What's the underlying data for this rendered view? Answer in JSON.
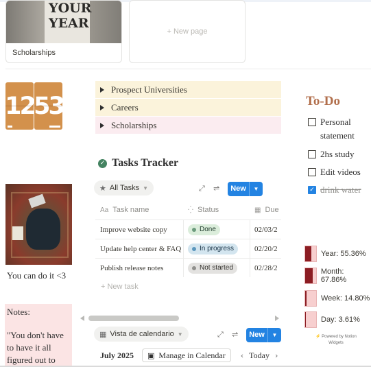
{
  "gallery": {
    "card_title": "Scholarships",
    "poster_lines": [
      "YOUR",
      "YEAR"
    ],
    "new_page": "+ New page"
  },
  "clock": {
    "hours": "12",
    "minutes": "53"
  },
  "toggles": [
    {
      "label": "Prospect Universities",
      "color": "#fbf3db"
    },
    {
      "label": "Careers",
      "color": "#fbf3db"
    },
    {
      "label": "Scholarships",
      "color": "#fbecf0"
    }
  ],
  "tasks": {
    "title": "Tasks Tracker",
    "view": "All Tasks",
    "new_label": "New",
    "columns": [
      "Task name",
      "Status",
      "Due"
    ],
    "rows": [
      {
        "name": "Improve website copy",
        "status": "Done",
        "due": "02/03/2"
      },
      {
        "name": "Update help center & FAQ",
        "status": "In progress",
        "due": "02/20/2"
      },
      {
        "name": "Publish release notes",
        "status": "Not started",
        "due": "02/28/2"
      }
    ],
    "new_task": "+ New task"
  },
  "calendar": {
    "view": "Vista de calendario",
    "new_label": "New",
    "month": "July 2025",
    "manage": "Manage in Calendar",
    "today": "Today"
  },
  "left": {
    "caption": "You can do it <3",
    "notes_title": "Notes:",
    "notes_body": "\"You don't have to have it all figured out to"
  },
  "todo": {
    "title": "To-Do",
    "items": [
      {
        "label": "Personal statement",
        "checked": false
      },
      {
        "label": "2hs study",
        "checked": false
      },
      {
        "label": "Edit videos",
        "checked": false
      },
      {
        "label": "drink water",
        "checked": true
      }
    ]
  },
  "progress": {
    "items": [
      {
        "label": "Year: 55.36%",
        "value": 55.36
      },
      {
        "label": "Month: 67.86%",
        "value": 67.86
      },
      {
        "label": "Week: 14.80%",
        "value": 14.8
      },
      {
        "label": "Day: 3.61%",
        "value": 3.61
      }
    ],
    "powered_line1": "Powered by Notion",
    "powered_line2": "Widgets",
    "fill_color": "#8c1d23",
    "track_color": "#f7cfcf"
  }
}
